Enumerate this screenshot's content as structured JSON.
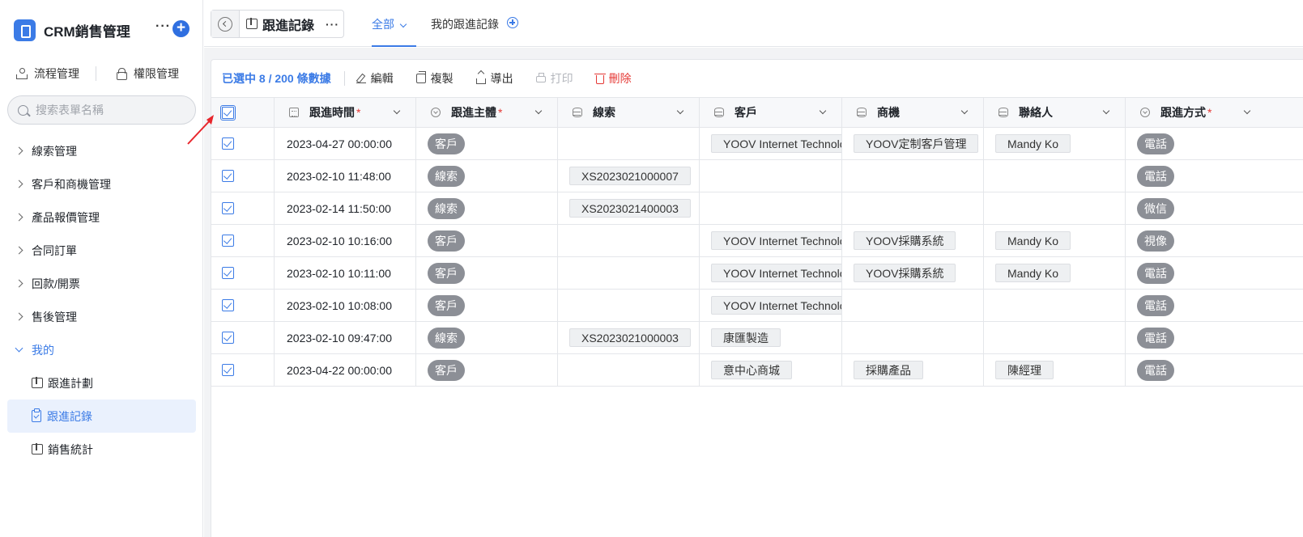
{
  "app": {
    "title": "CRM銷售管理",
    "more": "···",
    "add": "+"
  },
  "side_tools": {
    "flow": "流程管理",
    "perm": "權限管理"
  },
  "search": {
    "placeholder": "搜索表單名稱"
  },
  "nav": {
    "items": [
      "線索管理",
      "客戶和商機管理",
      "產品報價管理",
      "合同訂單",
      "回款/開票",
      "售後管理"
    ],
    "open_item": "我的",
    "sub_items": [
      "跟進計劃",
      "跟進記錄",
      "銷售統計"
    ]
  },
  "header": {
    "title": "跟進記錄",
    "more": "···",
    "tab_all": "全部",
    "tab_mine": "我的跟進記錄"
  },
  "toolbar": {
    "selection": "已選中 8 / 200 條數據",
    "edit": "編輯",
    "copy": "複製",
    "export": "導出",
    "print": "打印",
    "delete": "刪除"
  },
  "table": {
    "columns": [
      {
        "label": "跟進時間",
        "required": "*"
      },
      {
        "label": "跟進主體",
        "required": "*"
      },
      {
        "label": "線索",
        "required": ""
      },
      {
        "label": "客戶",
        "required": ""
      },
      {
        "label": "商機",
        "required": ""
      },
      {
        "label": "聯絡人",
        "required": ""
      },
      {
        "label": "跟進方式",
        "required": "*"
      }
    ],
    "rows": [
      {
        "time": "2023-04-27 00:00:00",
        "subject": "客戶",
        "lead": "",
        "customer": "YOOV Internet Technology",
        "opp": "YOOV定制客戶管理",
        "contact": "Mandy Ko",
        "method": "電話"
      },
      {
        "time": "2023-02-10 11:48:00",
        "subject": "線索",
        "lead": "XS2023021000007",
        "customer": "",
        "opp": "",
        "contact": "",
        "method": "電話"
      },
      {
        "time": "2023-02-14 11:50:00",
        "subject": "線索",
        "lead": "XS2023021400003",
        "customer": "",
        "opp": "",
        "contact": "",
        "method": "微信"
      },
      {
        "time": "2023-02-10 10:16:00",
        "subject": "客戶",
        "lead": "",
        "customer": "YOOV Internet Technology",
        "opp": "YOOV採購系統",
        "contact": "Mandy Ko",
        "method": "視像"
      },
      {
        "time": "2023-02-10 10:11:00",
        "subject": "客戶",
        "lead": "",
        "customer": "YOOV Internet Technology",
        "opp": "YOOV採購系統",
        "contact": "Mandy Ko",
        "method": "電話"
      },
      {
        "time": "2023-02-10 10:08:00",
        "subject": "客戶",
        "lead": "",
        "customer": "YOOV Internet Technology",
        "opp": "",
        "contact": "",
        "method": "電話"
      },
      {
        "time": "2023-02-10 09:47:00",
        "subject": "線索",
        "lead": "XS2023021000003",
        "customer": "康匯製造",
        "opp": "",
        "contact": "",
        "method": "電話"
      },
      {
        "time": "2023-04-22 00:00:00",
        "subject": "客戶",
        "lead": "",
        "customer": "意中心商城",
        "opp": "採購產品",
        "contact": "陳經理",
        "method": "電話"
      }
    ]
  },
  "colors": {
    "accent": "#3b7be6",
    "danger": "#e53935",
    "pill": "#8c8f96",
    "annotation": "#e8262c"
  }
}
